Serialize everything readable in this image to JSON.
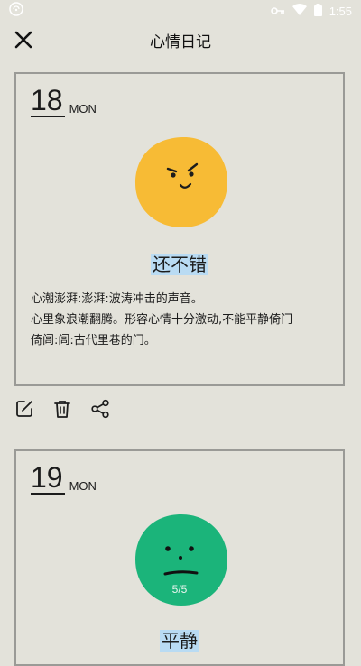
{
  "status_bar": {
    "time": "1:55"
  },
  "header": {
    "title": "心情日记"
  },
  "entries": [
    {
      "day": "18",
      "weekday": "MON",
      "mood": "还不错",
      "mood_color": "#f7bb35",
      "text_lines": [
        "心潮澎湃:澎湃:波涛冲击的声音。",
        "心里象浪潮翻腾。形容心情十分激动,不能平静倚门",
        "倚闾:闾:古代里巷的门。"
      ]
    },
    {
      "day": "19",
      "weekday": "MON",
      "mood": "平静",
      "mood_color": "#1bb47a",
      "page_counter": "5/5"
    }
  ],
  "actions": {
    "edit": "edit-icon",
    "delete": "trash-icon",
    "share": "share-icon"
  },
  "colors": {
    "background": "#e3e2da",
    "card_border": "#9a9a96",
    "highlight": "#b9dbf3"
  }
}
